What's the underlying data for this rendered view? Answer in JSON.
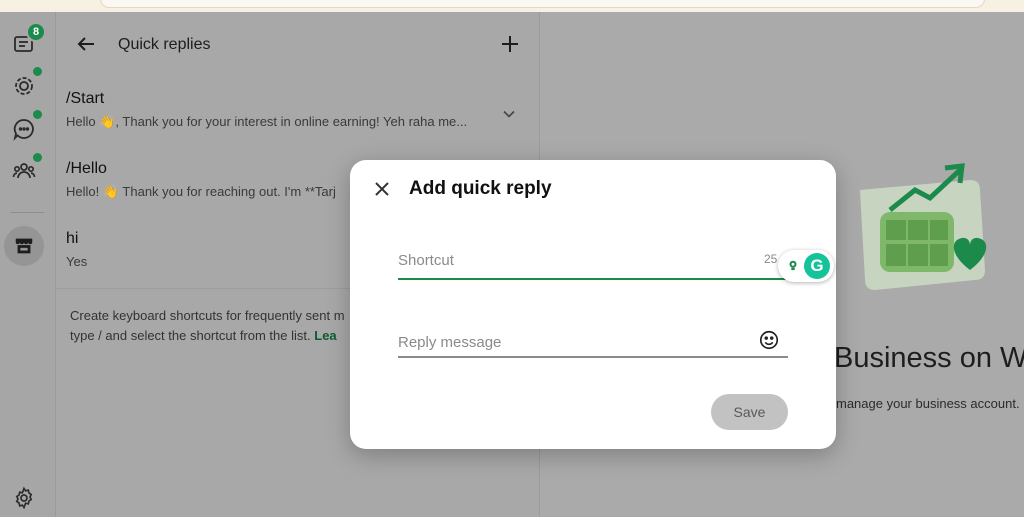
{
  "left_rail": {
    "chats_badge": "8",
    "icons": [
      "chats-icon",
      "status-icon",
      "channels-icon",
      "communities-icon",
      "business-tools-icon",
      "settings-icon"
    ]
  },
  "quick_replies": {
    "title": "Quick replies",
    "items": [
      {
        "shortcut": "/Start",
        "preview": "Hello 👋, Thank you for your interest in online earning! Yeh raha me..."
      },
      {
        "shortcut": "/Hello",
        "preview": "Hello! 👋 Thank you for reaching out. I'm **Tarj"
      },
      {
        "shortcut": "hi",
        "preview": "Yes"
      }
    ],
    "hint_text": "Create keyboard shortcuts for frequently sent m type / and select the shortcut from the list.",
    "hint_link": "Lea"
  },
  "promo": {
    "title": "Business on We",
    "subtitle": "manage your business account."
  },
  "dialog": {
    "title": "Add quick reply",
    "shortcut_placeholder": "Shortcut",
    "shortcut_value": "",
    "shortcut_counter": "25",
    "message_placeholder": "Reply message",
    "message_value": "",
    "save_label": "Save"
  },
  "colors": {
    "accent": "#1c8a4a",
    "overlay": "#a9a9a9",
    "grammarly": "#15c39a"
  }
}
